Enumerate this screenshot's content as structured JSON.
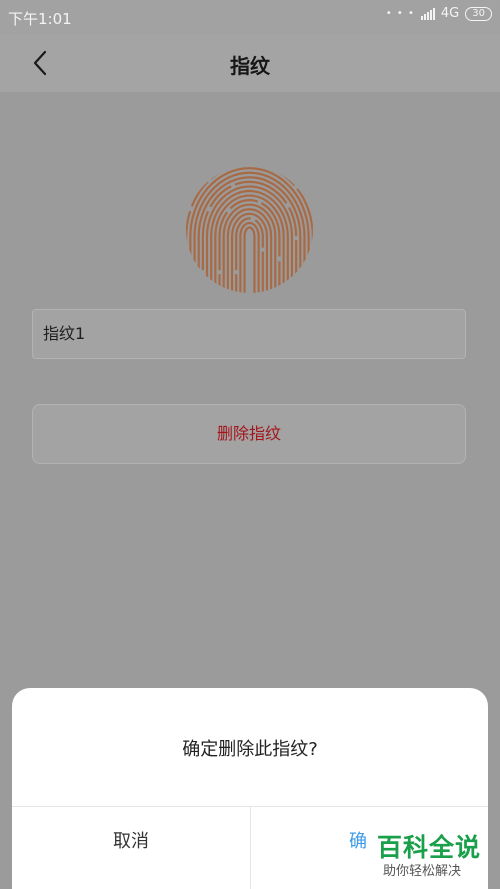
{
  "status_bar": {
    "time": "下午1:01",
    "network": "4G",
    "battery": "30"
  },
  "header": {
    "title": "指纹",
    "back_icon": "chevron-left-icon"
  },
  "fingerprint": {
    "icon": "fingerprint-icon",
    "color": "#b06a40"
  },
  "form": {
    "name_value": "指纹1",
    "delete_label": "删除指纹"
  },
  "dialog": {
    "message": "确定删除此指纹?",
    "cancel_label": "取消",
    "confirm_label": "确"
  },
  "watermark": {
    "brand": "百科全说",
    "slogan": "助你轻松解决"
  }
}
